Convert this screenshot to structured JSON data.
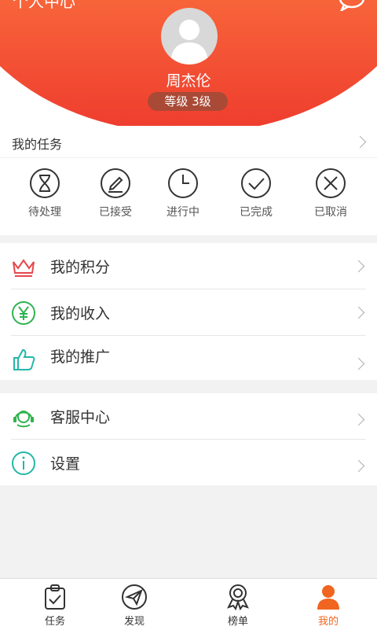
{
  "header": {
    "title": "个人中心",
    "username": "周杰伦",
    "level": "等级 3级"
  },
  "tasks": {
    "title": "我的任务",
    "items": [
      {
        "label": "待处理",
        "icon": "hourglass-icon"
      },
      {
        "label": "已接受",
        "icon": "edit-icon"
      },
      {
        "label": "进行中",
        "icon": "clock-icon"
      },
      {
        "label": "已完成",
        "icon": "check-circle-icon"
      },
      {
        "label": "已取消",
        "icon": "x-circle-icon"
      }
    ]
  },
  "menu1": [
    {
      "label": "我的积分",
      "icon": "crown-icon"
    },
    {
      "label": "我的收入",
      "icon": "yen-icon"
    },
    {
      "label": "我的推广",
      "icon": "thumbs-up-icon"
    }
  ],
  "menu2": [
    {
      "label": "客服中心",
      "icon": "headset-icon"
    },
    {
      "label": "设置",
      "icon": "info-icon"
    }
  ],
  "nav": [
    {
      "label": "任务",
      "icon": "clipboard-icon"
    },
    {
      "label": "发现",
      "icon": "paper-plane-icon"
    },
    {
      "label": "榜单",
      "icon": "medal-icon"
    },
    {
      "label": "我的",
      "icon": "user-icon",
      "active": true
    }
  ],
  "colors": {
    "accent": "#f0651f",
    "crown": "#e5484d",
    "yen": "#2fb34f",
    "teal": "#24b7a8"
  }
}
